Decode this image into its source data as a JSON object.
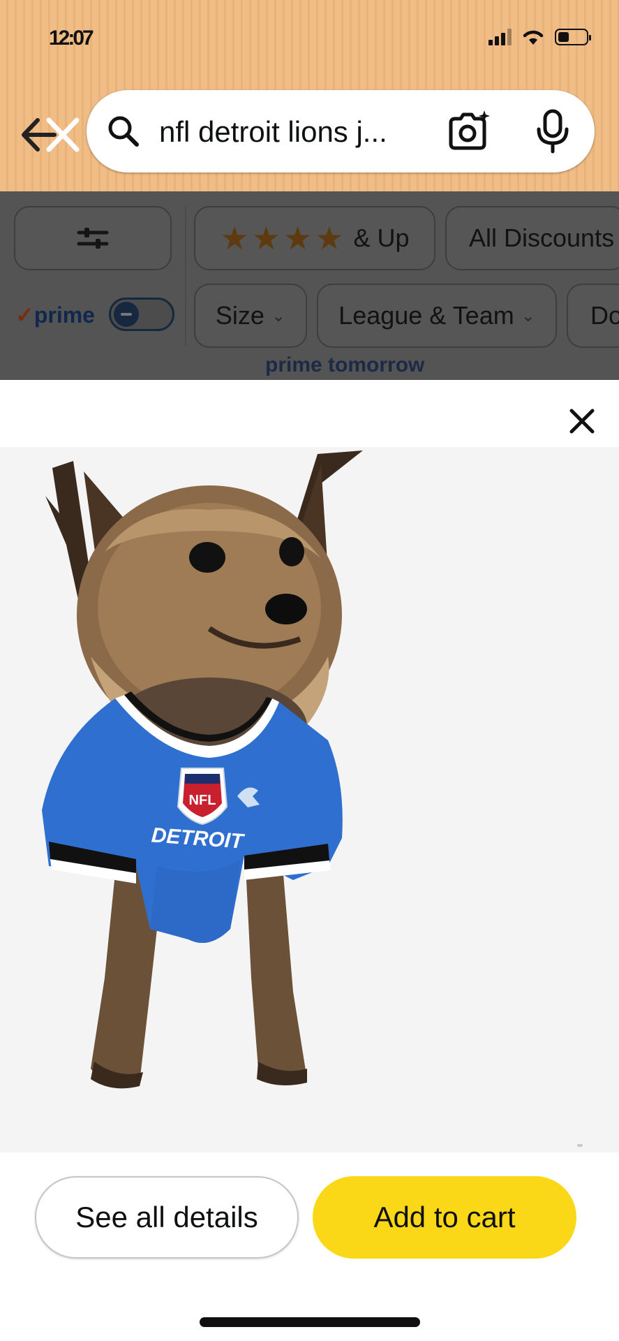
{
  "status_bar": {
    "time": "12:07",
    "battery_percent": 40
  },
  "search": {
    "query": "nfl detroit lions j...",
    "back_icon": "back-arrow-icon",
    "search_icon": "search-icon",
    "camera_icon": "camera-icon",
    "mic_icon": "mic-icon"
  },
  "filters": {
    "row1": {
      "filter_icon": "sliders-icon",
      "rating_label": "& Up",
      "rating_stars": 4,
      "discounts_label": "All Discounts"
    },
    "prime_label": "prime",
    "row2": {
      "size_label": "Size",
      "league_label": "League & Team",
      "next_label": "Do"
    },
    "peek_text": "prime  tomorrow"
  },
  "modal": {
    "close_icon": "close-icon",
    "image": {
      "jersey_text": "DETROIT",
      "logo_text": "NFL"
    },
    "see_details_label": "See all details",
    "add_to_cart_label": "Add to cart"
  },
  "colors": {
    "header_bg": "#f0bd86",
    "cart_button": "#fbd817",
    "dim_overlay": "#545454",
    "jersey_blue": "#2f6fd0"
  }
}
